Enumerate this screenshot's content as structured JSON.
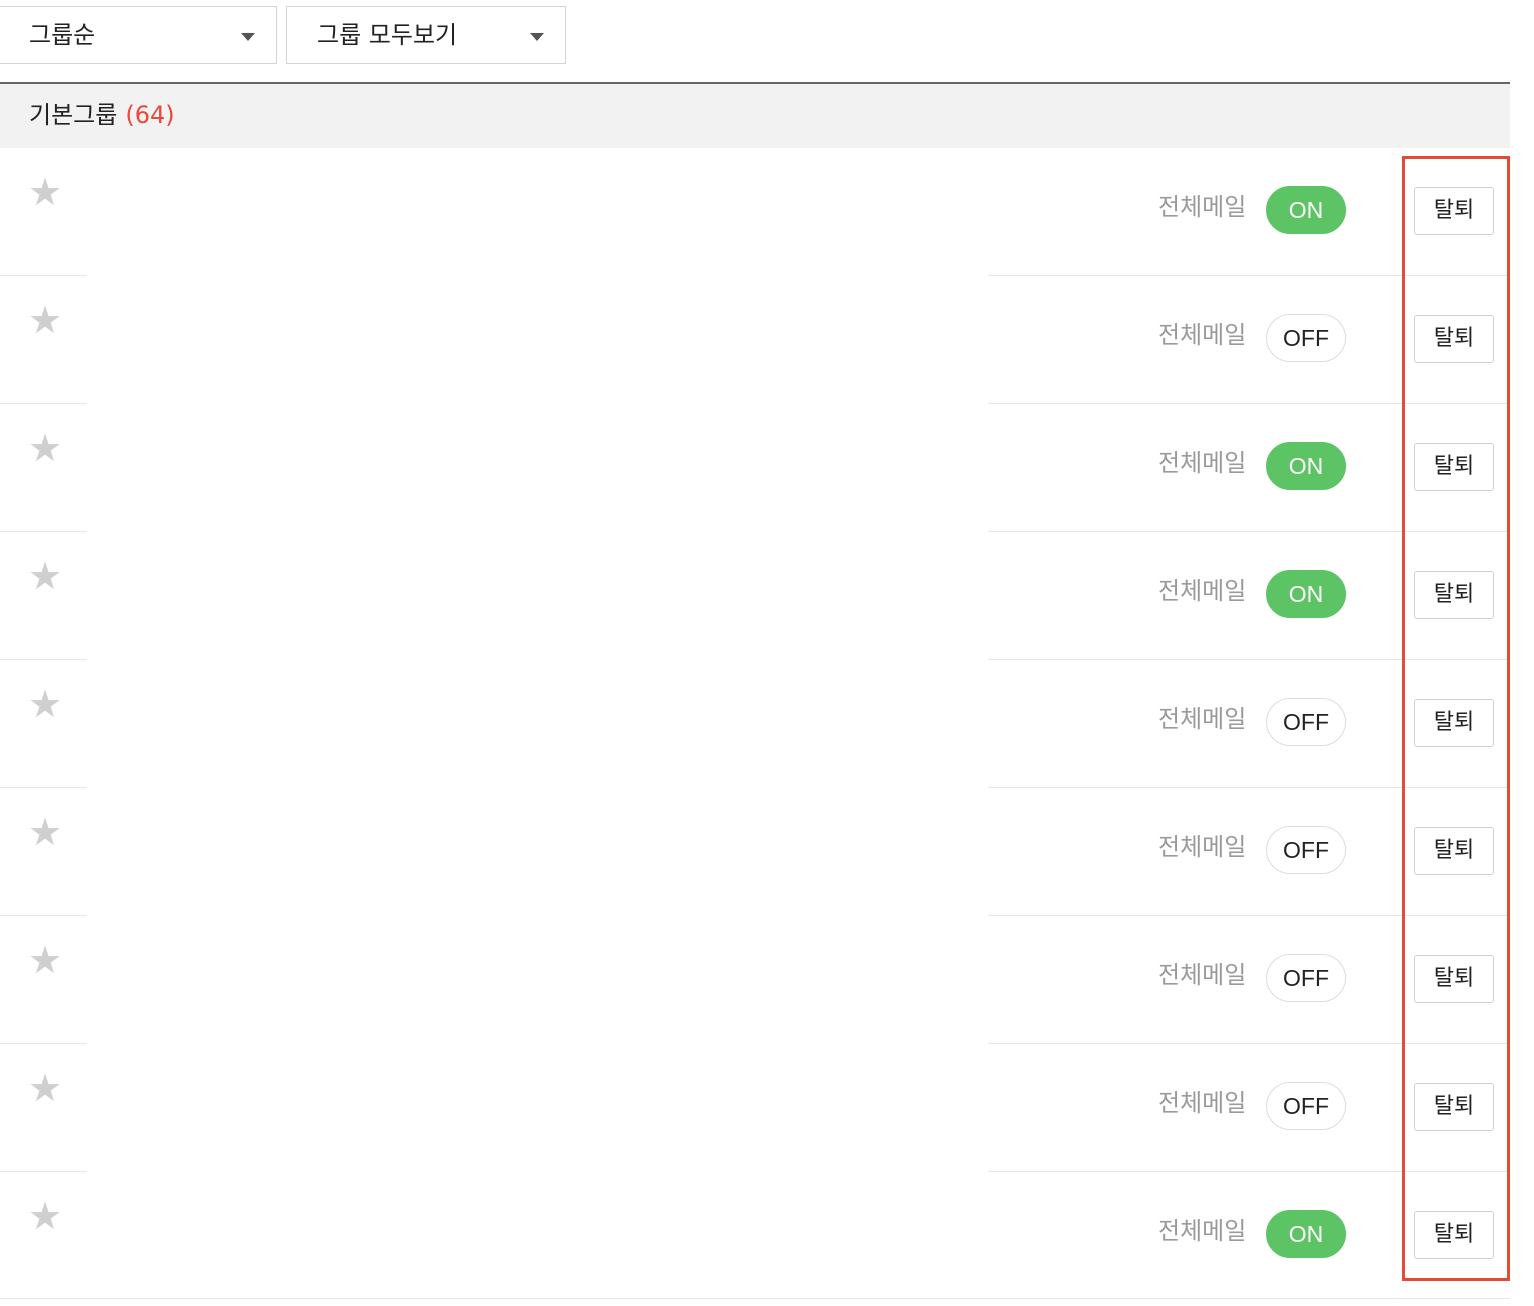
{
  "toolbar": {
    "sort_select": {
      "label": "그룹순"
    },
    "filter_select": {
      "label": "그룹 모두보기"
    }
  },
  "group": {
    "name": "기본그룹",
    "count": "(64)"
  },
  "rows": [
    {
      "star": "★",
      "mail_label": "전체메일",
      "toggle": "ON",
      "toggle_state": "on",
      "leave_label": "탈퇴"
    },
    {
      "star": "★",
      "mail_label": "전체메일",
      "toggle": "OFF",
      "toggle_state": "off",
      "leave_label": "탈퇴"
    },
    {
      "star": "★",
      "mail_label": "전체메일",
      "toggle": "ON",
      "toggle_state": "on",
      "leave_label": "탈퇴"
    },
    {
      "star": "★",
      "mail_label": "전체메일",
      "toggle": "ON",
      "toggle_state": "on",
      "leave_label": "탈퇴"
    },
    {
      "star": "★",
      "mail_label": "전체메일",
      "toggle": "OFF",
      "toggle_state": "off",
      "leave_label": "탈퇴"
    },
    {
      "star": "★",
      "mail_label": "전체메일",
      "toggle": "OFF",
      "toggle_state": "off",
      "leave_label": "탈퇴"
    },
    {
      "star": "★",
      "mail_label": "전체메일",
      "toggle": "OFF",
      "toggle_state": "off",
      "leave_label": "탈퇴"
    },
    {
      "star": "★",
      "mail_label": "전체메일",
      "toggle": "OFF",
      "toggle_state": "off",
      "leave_label": "탈퇴"
    },
    {
      "star": "★",
      "mail_label": "전체메일",
      "toggle": "ON",
      "toggle_state": "on",
      "leave_label": "탈퇴"
    }
  ],
  "colors": {
    "toggle_on": "#5cc464",
    "count": "#e8493c",
    "highlight": "#e34b34"
  }
}
